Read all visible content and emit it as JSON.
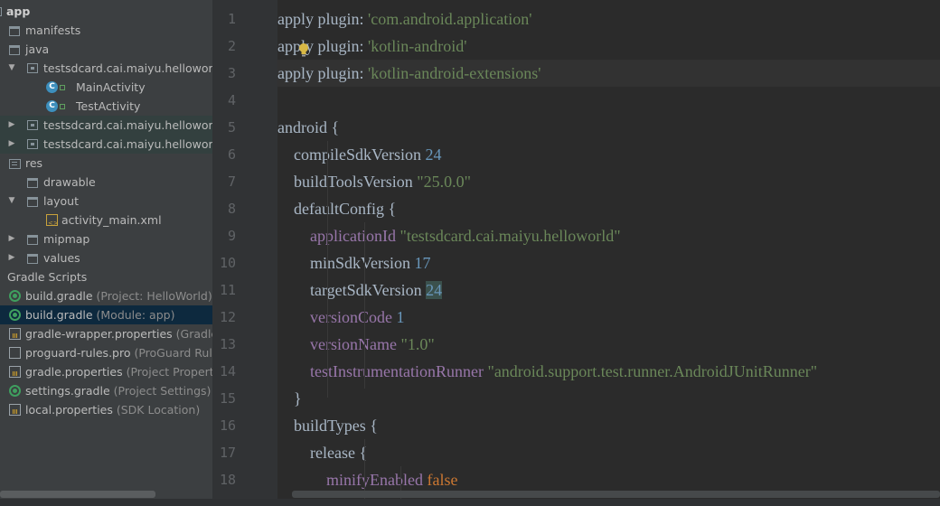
{
  "project_tree": {
    "root": "app",
    "items": [
      {
        "label": "manifests",
        "hint": "",
        "icon": "folder-icon",
        "arrow": ""
      },
      {
        "label": "java",
        "hint": "",
        "icon": "folder-icon",
        "arrow": ""
      },
      {
        "label": "testsdcard.cai.maiyu.helloworld",
        "hint": "",
        "icon": "package-icon",
        "arrow": "▼"
      },
      {
        "label": "MainActivity",
        "hint": "",
        "icon": "class-icon",
        "arrow": ""
      },
      {
        "label": "TestActivity",
        "hint": "",
        "icon": "class-icon",
        "arrow": ""
      },
      {
        "label": "testsdcard.cai.maiyu.helloworld",
        "hint": "(",
        "icon": "package-icon",
        "arrow": "▶"
      },
      {
        "label": "testsdcard.cai.maiyu.helloworld",
        "hint": "(",
        "icon": "package-icon",
        "arrow": "▶"
      },
      {
        "label": "res",
        "hint": "",
        "icon": "resources-folder-icon",
        "arrow": ""
      },
      {
        "label": "drawable",
        "hint": "",
        "icon": "folder-icon",
        "arrow": ""
      },
      {
        "label": "layout",
        "hint": "",
        "icon": "folder-icon",
        "arrow": "▼"
      },
      {
        "label": "activity_main.xml",
        "hint": "",
        "icon": "xml-file-icon",
        "arrow": ""
      },
      {
        "label": "mipmap",
        "hint": "",
        "icon": "folder-icon",
        "arrow": "▶"
      },
      {
        "label": "values",
        "hint": "",
        "icon": "folder-icon",
        "arrow": "▶"
      },
      {
        "label": "Gradle Scripts",
        "hint": "",
        "icon": "gradle-scripts-icon",
        "arrow": ""
      },
      {
        "label": "build.gradle",
        "hint": "(Project: HelloWorld)",
        "icon": "gradle-icon",
        "arrow": ""
      },
      {
        "label": "build.gradle",
        "hint": "(Module: app)",
        "icon": "gradle-icon",
        "arrow": ""
      },
      {
        "label": "gradle-wrapper.properties",
        "hint": "(Gradle",
        "icon": "properties-file-icon",
        "arrow": ""
      },
      {
        "label": "proguard-rules.pro",
        "hint": "(ProGuard Rule",
        "icon": "text-file-icon",
        "arrow": ""
      },
      {
        "label": "gradle.properties",
        "hint": "(Project Propertie",
        "icon": "properties-file-icon",
        "arrow": ""
      },
      {
        "label": "settings.gradle",
        "hint": "(Project Settings)",
        "icon": "gradle-icon",
        "arrow": ""
      },
      {
        "label": "local.properties",
        "hint": "(SDK Location)",
        "icon": "properties-file-icon",
        "arrow": ""
      }
    ]
  },
  "editor": {
    "line_numbers": [
      "1",
      "2",
      "3",
      "4",
      "5",
      "6",
      "7",
      "8",
      "9",
      "10",
      "11",
      "12",
      "13",
      "14",
      "15",
      "16",
      "17",
      "18"
    ],
    "lines": [
      [
        {
          "t": "apply plugin: ",
          "c": "plain"
        },
        {
          "t": "'com.android.application'",
          "c": "str"
        }
      ],
      [
        {
          "t": "apply plugin: ",
          "c": "plain"
        },
        {
          "t": "'kotlin-android'",
          "c": "str"
        }
      ],
      [
        {
          "t": "apply plugin: ",
          "c": "plain"
        },
        {
          "t": "'kotlin-android-extensions'",
          "c": "str"
        }
      ],
      [],
      [
        {
          "t": "android {",
          "c": "plain"
        }
      ],
      [
        {
          "t": "    compileSdkVersion ",
          "c": "plain"
        },
        {
          "t": "24",
          "c": "num"
        }
      ],
      [
        {
          "t": "    buildToolsVersion ",
          "c": "plain"
        },
        {
          "t": "\"25.0.0\"",
          "c": "str"
        }
      ],
      [
        {
          "t": "    defaultConfig {",
          "c": "plain"
        }
      ],
      [
        {
          "t": "        applicationId ",
          "c": "prop"
        },
        {
          "t": "\"testsdcard.cai.maiyu.helloworld\"",
          "c": "str"
        }
      ],
      [
        {
          "t": "        minSdkVersion ",
          "c": "plain"
        },
        {
          "t": "17",
          "c": "num"
        }
      ],
      [
        {
          "t": "        targetSdkVersion ",
          "c": "plain"
        },
        {
          "t": "24",
          "c": "num mark"
        }
      ],
      [
        {
          "t": "        versionCode ",
          "c": "prop"
        },
        {
          "t": "1",
          "c": "num"
        }
      ],
      [
        {
          "t": "        versionName ",
          "c": "prop"
        },
        {
          "t": "\"1.0\"",
          "c": "str"
        }
      ],
      [
        {
          "t": "        testInstrumentationRunner ",
          "c": "prop"
        },
        {
          "t": "\"android.support.test.runner.AndroidJUnitRunner\"",
          "c": "str"
        }
      ],
      [
        {
          "t": "    }",
          "c": "plain"
        }
      ],
      [
        {
          "t": "    buildTypes {",
          "c": "plain"
        }
      ],
      [
        {
          "t": "        release {",
          "c": "plain"
        }
      ],
      [
        {
          "t": "            minifyEnabled ",
          "c": "prop"
        },
        {
          "t": "false",
          "c": "kw"
        }
      ]
    ],
    "current_line": 3,
    "folds": [
      5,
      8,
      15,
      16,
      17
    ]
  },
  "colors": {
    "background": "#2b2b2b",
    "string": "#6a8759",
    "number": "#6897bb",
    "keyword": "#cc7832",
    "property": "#9876aa",
    "text": "#a9b7c6"
  }
}
